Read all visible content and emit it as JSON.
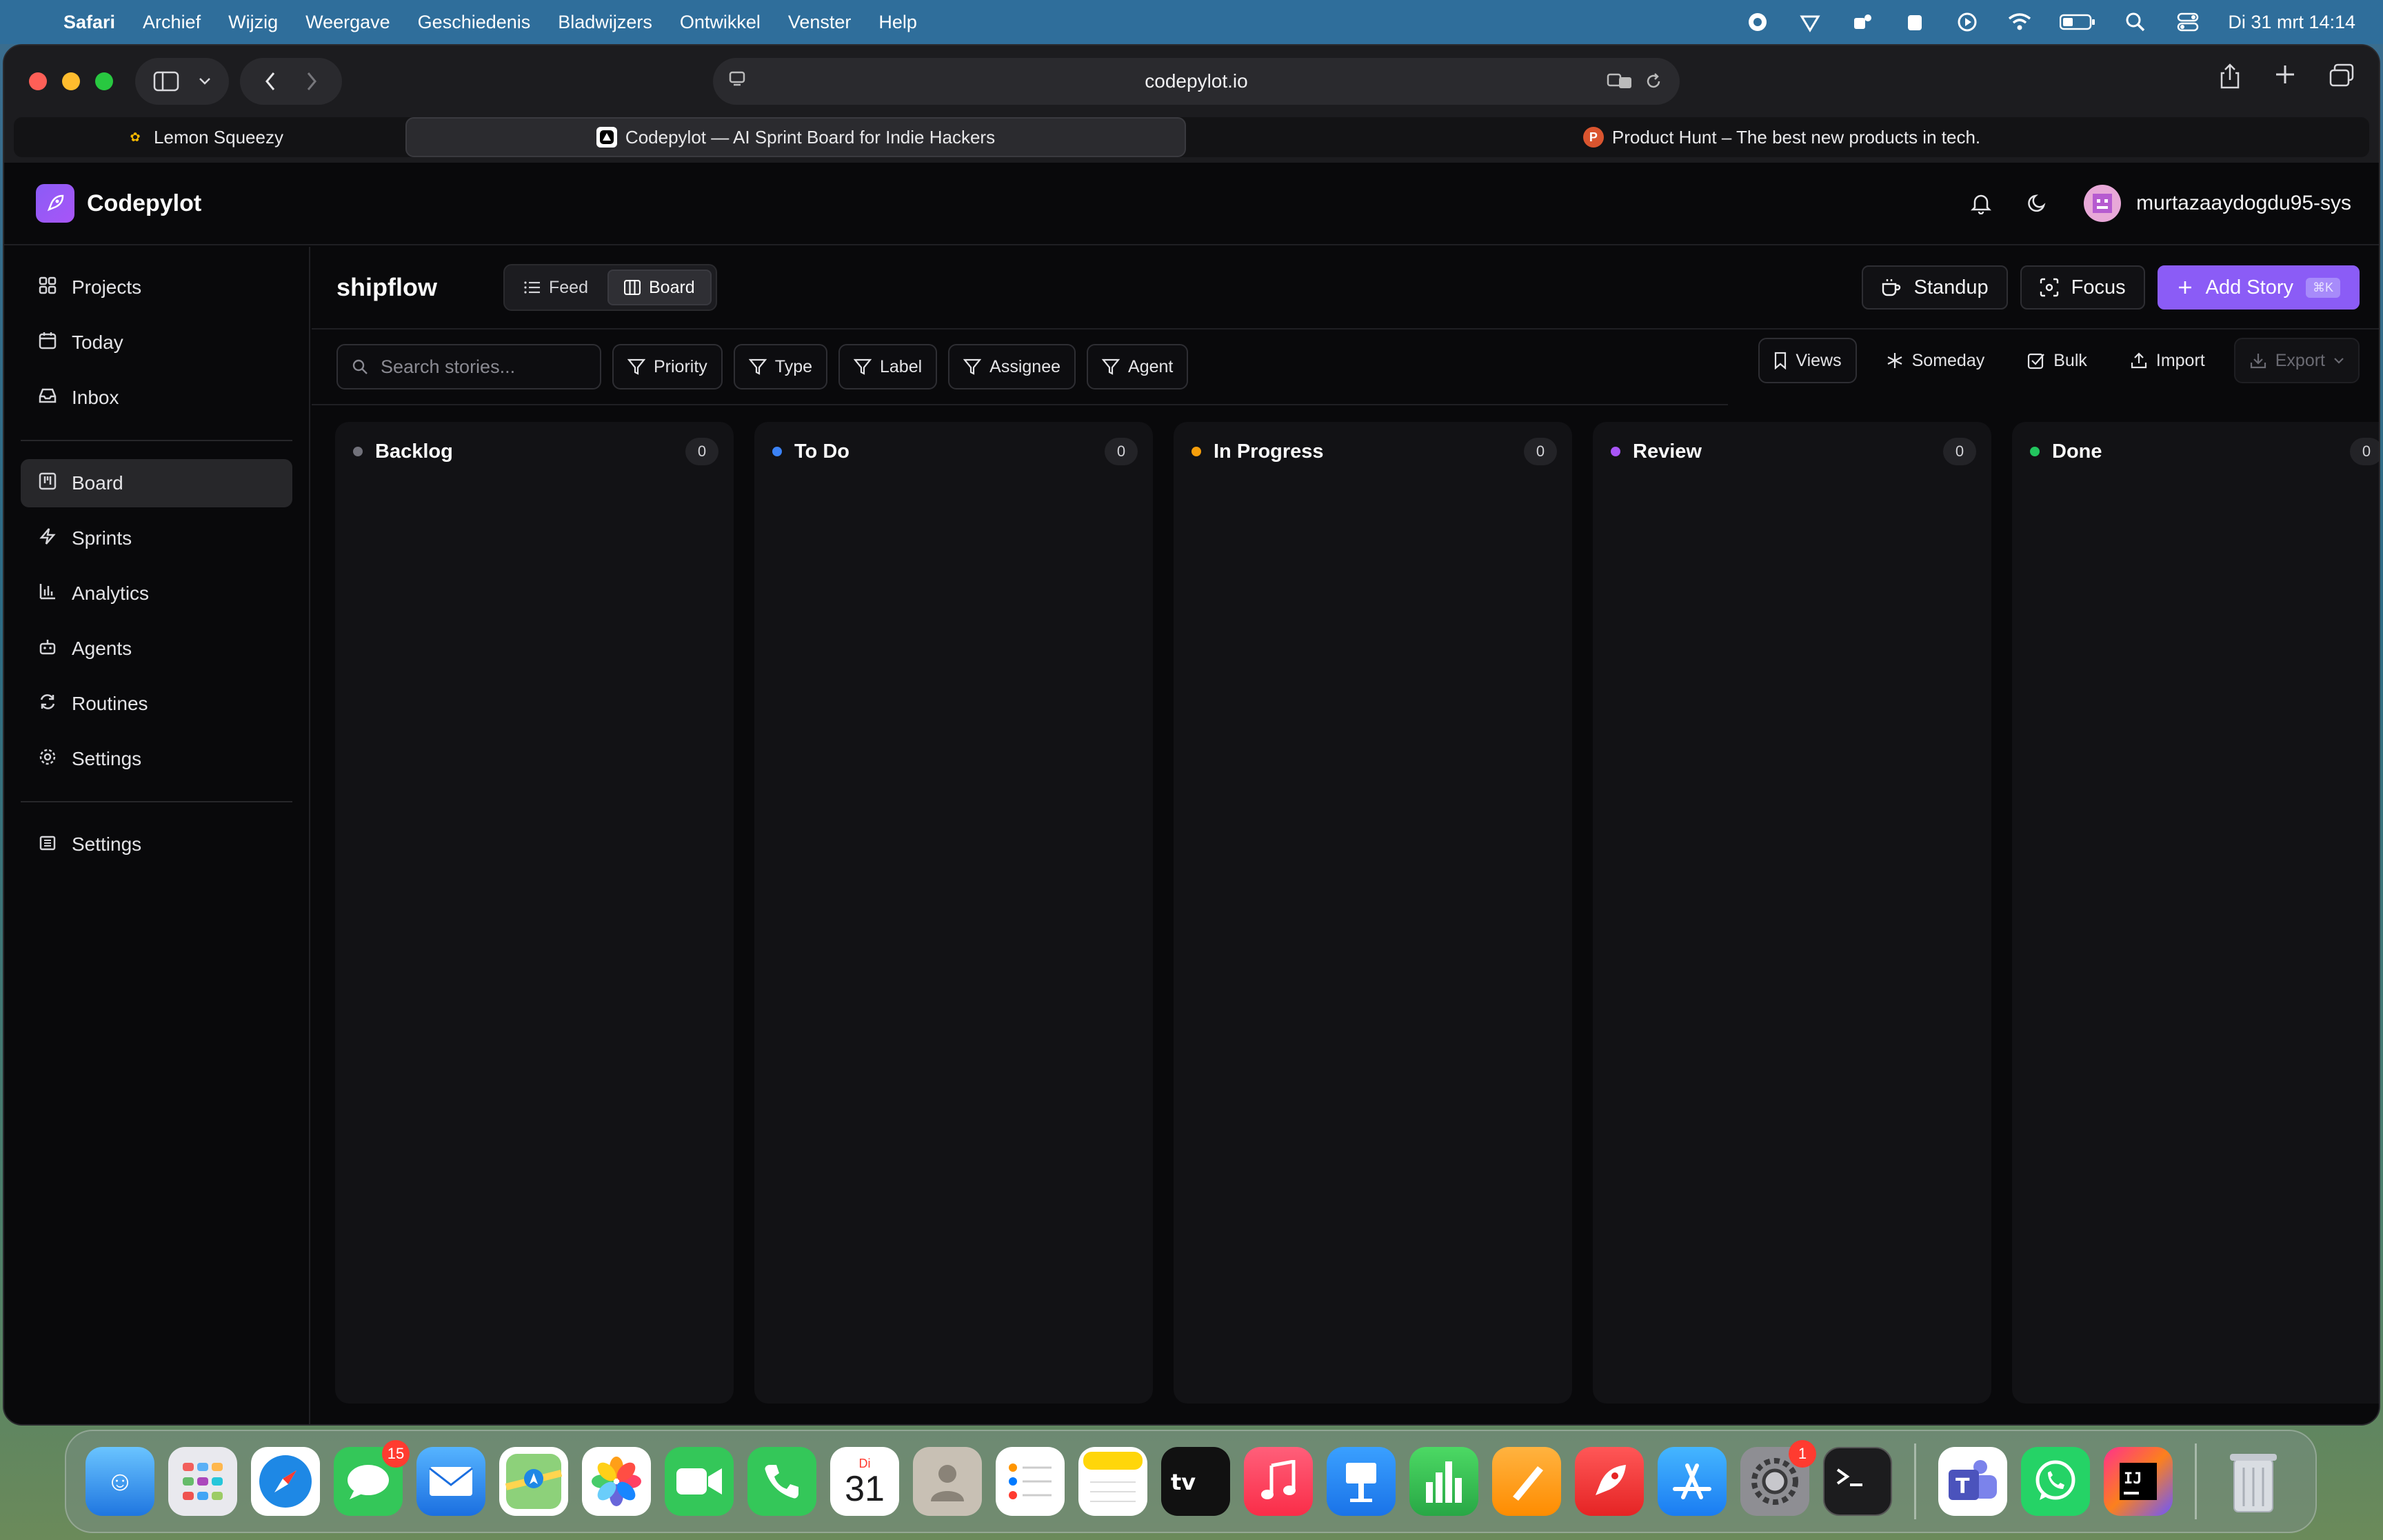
{
  "menubar": {
    "app_name": "Safari",
    "items": [
      "Archief",
      "Wijzig",
      "Weergave",
      "Geschiedenis",
      "Bladwijzers",
      "Ontwikkel",
      "Venster",
      "Help"
    ],
    "datetime": "Di 31 mrt  14:14"
  },
  "browser": {
    "url": "codepylot.io",
    "tabs": [
      {
        "label": "Lemon Squeezy"
      },
      {
        "label": "Codepylot — AI Sprint Board for Indie Hackers"
      },
      {
        "label": "Product Hunt – The best new products in tech."
      }
    ]
  },
  "app": {
    "brand": "Codepylot",
    "username": "murtazaaydogdu95-sys"
  },
  "sidebar": {
    "items": [
      {
        "label": "Projects",
        "icon": "grid-icon"
      },
      {
        "label": "Today",
        "icon": "calendar-icon"
      },
      {
        "label": "Inbox",
        "icon": "inbox-icon"
      },
      {
        "label": "Board",
        "icon": "board-icon"
      },
      {
        "label": "Sprints",
        "icon": "bolt-icon"
      },
      {
        "label": "Analytics",
        "icon": "bar-chart-icon"
      },
      {
        "label": "Agents",
        "icon": "bot-icon"
      },
      {
        "label": "Routines",
        "icon": "refresh-icon"
      },
      {
        "label": "Settings",
        "icon": "gear-icon"
      },
      {
        "label": "Settings",
        "icon": "building-icon"
      }
    ]
  },
  "main": {
    "project_name": "shipflow",
    "views": {
      "feed": "Feed",
      "board": "Board"
    },
    "actions": {
      "standup": "Standup",
      "focus": "Focus",
      "add_story": "Add Story",
      "shortcut": "⌘K"
    },
    "search_placeholder": "Search stories...",
    "filters": [
      "Priority",
      "Type",
      "Label",
      "Assignee",
      "Agent"
    ],
    "right_tools": {
      "views": "Views",
      "someday": "Someday",
      "bulk": "Bulk",
      "import": "Import",
      "export": "Export"
    }
  },
  "columns": [
    {
      "title": "Backlog",
      "count": "0",
      "color": "#71717a"
    },
    {
      "title": "To Do",
      "count": "0",
      "color": "#3b82f6"
    },
    {
      "title": "In Progress",
      "count": "0",
      "color": "#f59e0b"
    },
    {
      "title": "Review",
      "count": "0",
      "color": "#a855f7"
    },
    {
      "title": "Done",
      "count": "0",
      "color": "#22c55e"
    }
  ],
  "dock": {
    "messages_badge": "15",
    "calendar_day": "Di",
    "calendar_date": "31",
    "settings_badge": "1"
  }
}
